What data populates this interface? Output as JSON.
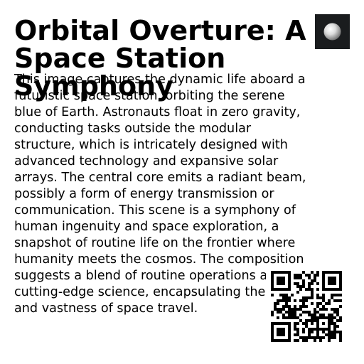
{
  "document": {
    "title": "Orbital Overture: A Space Station Symphony",
    "body": "This image captures the dynamic life aboard a futuristic space station, orbiting the serene blue of Earth. Astronauts float in zero gravity, conducting tasks outside the modular structure, which is intricately designed with advanced technology and expansive solar arrays. The central core emits a radiant beam, possibly a form of energy transmission or communication. This scene is a symphony of human ingenuity and space exploration, a snapshot of routine life on the frontier where humanity meets the cosmos. The composition suggests a blend of routine operations and cutting-edge science, encapsulating the thrill and vastness of space travel."
  },
  "colors": {
    "text": "#000000",
    "thumbnail_bg": "#1a1c1e",
    "sphere": "#e8e8e8"
  },
  "icons": {
    "thumbnail": "moon-sphere-icon",
    "qr": "qr-code-icon"
  }
}
